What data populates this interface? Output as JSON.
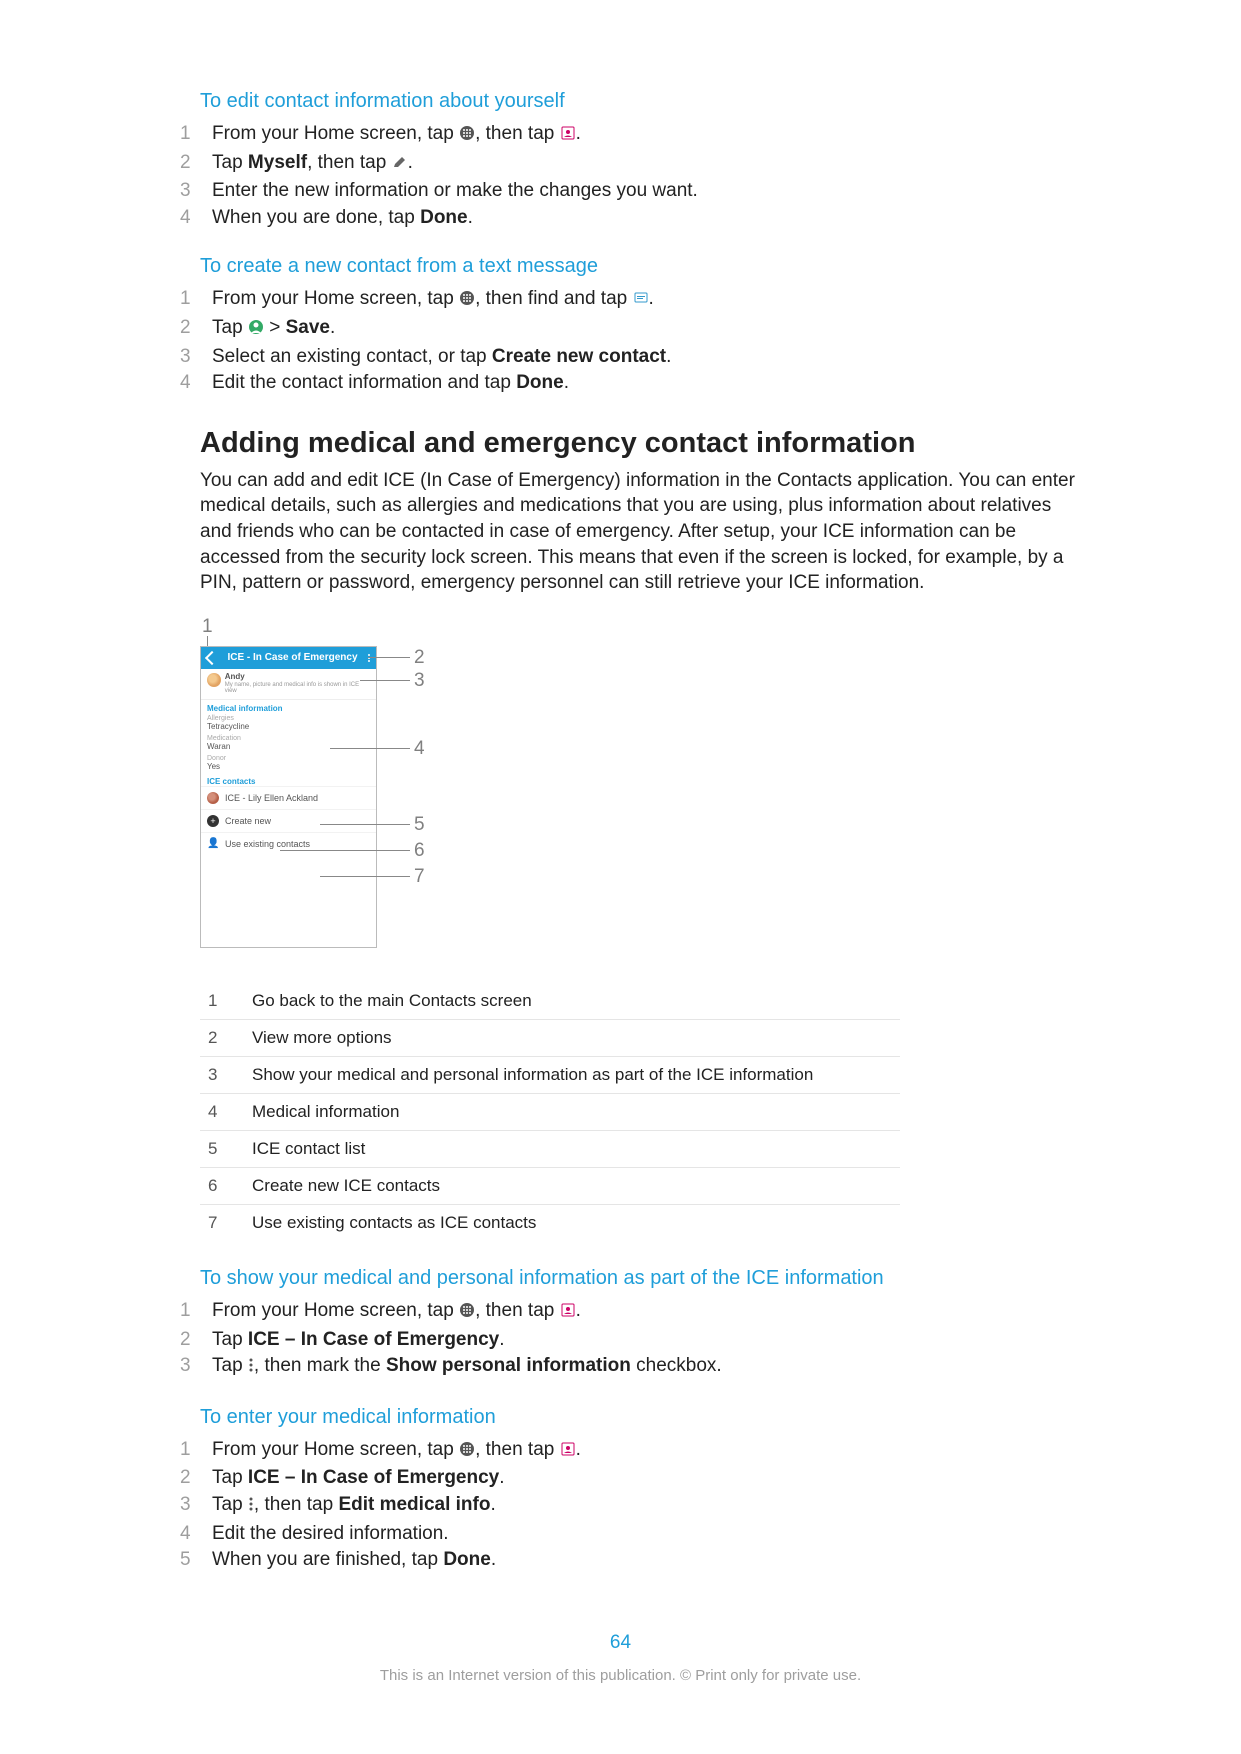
{
  "section1": {
    "title": "To edit contact information about yourself",
    "steps": [
      {
        "parts": [
          {
            "t": "From your Home screen, tap "
          },
          {
            "icon": "apps"
          },
          {
            "t": ", then tap "
          },
          {
            "icon": "contact"
          },
          {
            "t": "."
          }
        ]
      },
      {
        "parts": [
          {
            "t": "Tap "
          },
          {
            "bold": "Myself"
          },
          {
            "t": ", then tap "
          },
          {
            "icon": "edit"
          },
          {
            "t": "."
          }
        ]
      },
      {
        "parts": [
          {
            "t": "Enter the new information or make the changes you want."
          }
        ]
      },
      {
        "parts": [
          {
            "t": "When you are done, tap "
          },
          {
            "bold": "Done"
          },
          {
            "t": "."
          }
        ]
      }
    ]
  },
  "section2": {
    "title": "To create a new contact from a text message",
    "steps": [
      {
        "parts": [
          {
            "t": "From your Home screen, tap "
          },
          {
            "icon": "apps"
          },
          {
            "t": ", then find and tap "
          },
          {
            "icon": "messaging"
          },
          {
            "t": "."
          }
        ]
      },
      {
        "parts": [
          {
            "t": "Tap "
          },
          {
            "icon": "avatar"
          },
          {
            "t": " > "
          },
          {
            "bold": "Save"
          },
          {
            "t": "."
          }
        ]
      },
      {
        "parts": [
          {
            "t": "Select an existing contact, or tap "
          },
          {
            "bold": "Create new contact"
          },
          {
            "t": "."
          }
        ]
      },
      {
        "parts": [
          {
            "t": "Edit the contact information and tap "
          },
          {
            "bold": "Done"
          },
          {
            "t": "."
          }
        ]
      }
    ]
  },
  "heading": "Adding medical and emergency contact information",
  "intro": "You can add and edit ICE (In Case of Emergency) information in the Contacts application. You can enter medical details, such as allergies and medications that you are using, plus information about relatives and friends who can be contacted in case of emergency. After setup, your ICE information can be accessed from the security lock screen. This means that even if the screen is locked, for example, by a PIN, pattern or password, emergency personnel can still retrieve your ICE information.",
  "diagram": {
    "header_title": "ICE - In Case of Emergency",
    "user_name": "Andy",
    "user_sub": "My name, picture and medical info is shown in ICE view",
    "medinfo_title": "Medical information",
    "allergies_lbl": "Allergies",
    "allergies_val": "Tetracycline",
    "medication_lbl": "Medication",
    "medication_val": "Waran",
    "donor_lbl": "Donor",
    "donor_val": "Yes",
    "ice_title": "ICE contacts",
    "ice_contact": "ICE - Lily Ellen Ackland",
    "create_new": "Create new",
    "use_existing": "Use existing contacts"
  },
  "legend": [
    {
      "n": "1",
      "d": "Go back to the main Contacts screen"
    },
    {
      "n": "2",
      "d": "View more options"
    },
    {
      "n": "3",
      "d": "Show your medical and personal information as part of the ICE information"
    },
    {
      "n": "4",
      "d": "Medical information"
    },
    {
      "n": "5",
      "d": "ICE contact list"
    },
    {
      "n": "6",
      "d": "Create new ICE contacts"
    },
    {
      "n": "7",
      "d": "Use existing contacts as ICE contacts"
    }
  ],
  "section3": {
    "title": "To show your medical and personal information as part of the ICE information",
    "steps": [
      {
        "parts": [
          {
            "t": "From your Home screen, tap "
          },
          {
            "icon": "apps"
          },
          {
            "t": ", then tap "
          },
          {
            "icon": "contact"
          },
          {
            "t": "."
          }
        ]
      },
      {
        "parts": [
          {
            "t": "Tap "
          },
          {
            "bold": "ICE – In Case of Emergency"
          },
          {
            "t": "."
          }
        ]
      },
      {
        "parts": [
          {
            "t": "Tap "
          },
          {
            "icon": "kebab"
          },
          {
            "t": ", then mark the "
          },
          {
            "bold": "Show personal information"
          },
          {
            "t": " checkbox."
          }
        ]
      }
    ]
  },
  "section4": {
    "title": "To enter your medical information",
    "steps": [
      {
        "parts": [
          {
            "t": "From your Home screen, tap "
          },
          {
            "icon": "apps"
          },
          {
            "t": ", then tap "
          },
          {
            "icon": "contact"
          },
          {
            "t": "."
          }
        ]
      },
      {
        "parts": [
          {
            "t": "Tap "
          },
          {
            "bold": "ICE – In Case of Emergency"
          },
          {
            "t": "."
          }
        ]
      },
      {
        "parts": [
          {
            "t": "Tap "
          },
          {
            "icon": "kebab"
          },
          {
            "t": ", then tap "
          },
          {
            "bold": "Edit medical info"
          },
          {
            "t": "."
          }
        ]
      },
      {
        "parts": [
          {
            "t": "Edit the desired information."
          }
        ]
      },
      {
        "parts": [
          {
            "t": "When you are finished, tap "
          },
          {
            "bold": "Done"
          },
          {
            "t": "."
          }
        ]
      }
    ]
  },
  "page_number": "64",
  "footer": "This is an Internet version of this publication. © Print only for private use."
}
